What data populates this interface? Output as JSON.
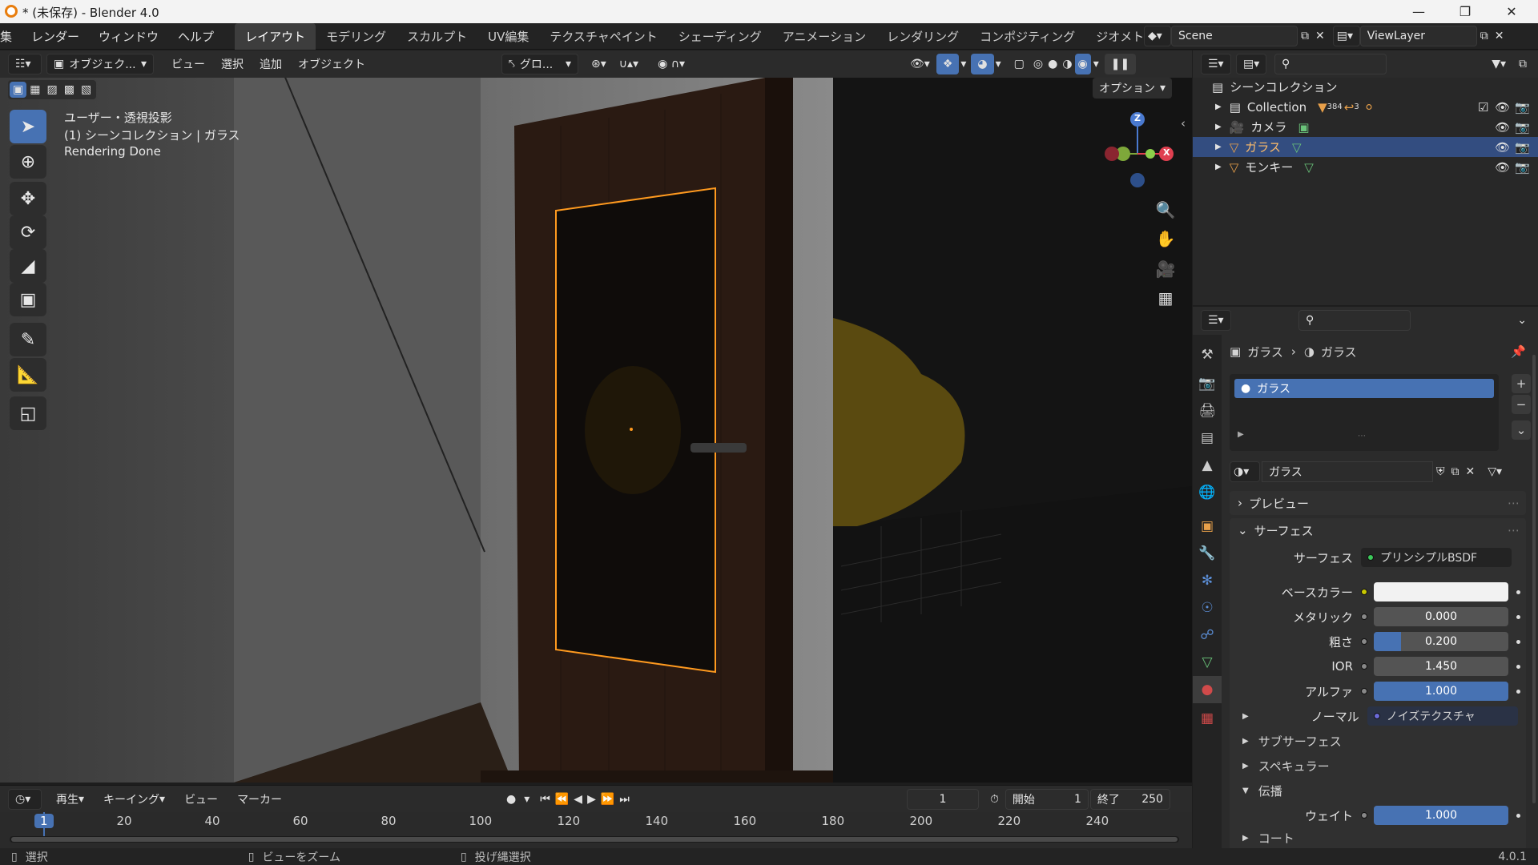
{
  "window": {
    "title": "* (未保存) - Blender 4.0"
  },
  "menu": [
    "集",
    "レンダー",
    "ウィンドウ",
    "ヘルプ"
  ],
  "workspaces": [
    {
      "label": "レイアウト",
      "active": true
    },
    {
      "label": "モデリング"
    },
    {
      "label": "スカルプト"
    },
    {
      "label": "UV編集"
    },
    {
      "label": "テクスチャペイント"
    },
    {
      "label": "シェーディング"
    },
    {
      "label": "アニメーション"
    },
    {
      "label": "レンダリング"
    },
    {
      "label": "コンポジティング"
    },
    {
      "label": "ジオメトリノード"
    }
  ],
  "scene": {
    "name": "Scene"
  },
  "view_layer": {
    "name": "ViewLayer"
  },
  "viewport_header": {
    "mode": "オブジェク...",
    "menus": [
      "ビュー",
      "選択",
      "追加",
      "オブジェクト"
    ],
    "transform_orientation": "グロ...",
    "options": "オプション"
  },
  "viewport_overlay": {
    "projection": "ユーザー・透視投影",
    "collection": "(1) シーンコレクション | ガラス",
    "status": "Rendering Done"
  },
  "gizmo": {
    "z": "Z",
    "x": "X",
    "y": "Y"
  },
  "tools": [
    "select-icon",
    "cursor-icon",
    "move-icon",
    "rotate-icon",
    "scale-icon",
    "transform-icon",
    "annotate-icon",
    "measure-icon",
    "add-cube-icon"
  ],
  "outliner": {
    "root": "シーンコレクション",
    "items": [
      {
        "name": "Collection",
        "badge": "384",
        "badge2": "3"
      },
      {
        "name": "カメラ"
      },
      {
        "name": "ガラス",
        "selected": true
      },
      {
        "name": "モンキー"
      }
    ]
  },
  "properties": {
    "breadcrumb_object": "ガラス",
    "breadcrumb_material": "ガラス",
    "slot": "ガラス",
    "material_name": "ガラス",
    "panels": {
      "preview": "プレビュー",
      "surface": "サーフェス"
    },
    "surface_label": "サーフェス",
    "surface_value": "プリンシプルBSDF",
    "fields": [
      {
        "label": "ベースカラー",
        "type": "color",
        "socket": "#c8c800"
      },
      {
        "label": "メタリック",
        "value": "0.000",
        "fill": 0.0,
        "socket": "#888888"
      },
      {
        "label": "粗さ",
        "value": "0.200",
        "fill": 0.2,
        "socket": "#888888"
      },
      {
        "label": "IOR",
        "value": "1.450",
        "fill": 0.0,
        "socket": "#888888"
      },
      {
        "label": "アルファ",
        "value": "1.000",
        "fill": 1.0,
        "socket": "#888888"
      }
    ],
    "normal_label": "ノーマル",
    "normal_value": "ノイズテクスチャ",
    "subsections": [
      "サブサーフェス",
      "スペキュラー",
      "伝播"
    ],
    "weight_label": "ウェイト",
    "weight_value": "1.000",
    "weight_fill": 1.0,
    "coat_label": "コート"
  },
  "timeline": {
    "menus": [
      "再生",
      "キーイング",
      "ビュー",
      "マーカー"
    ],
    "current_frame": "1",
    "start_label": "開始",
    "start": "1",
    "end_label": "終了",
    "end": "250",
    "ticks": [
      "1",
      "20",
      "40",
      "60",
      "80",
      "100",
      "120",
      "140",
      "160",
      "180",
      "200",
      "220",
      "240"
    ]
  },
  "statusbar": {
    "select": "選択",
    "zoom": "ビューをズーム",
    "lasso": "投げ縄選択",
    "version": "4.0.1"
  },
  "colors": {
    "accent": "#4772b3",
    "selection": "#ff9a1f",
    "header": "#2b2b2b"
  }
}
